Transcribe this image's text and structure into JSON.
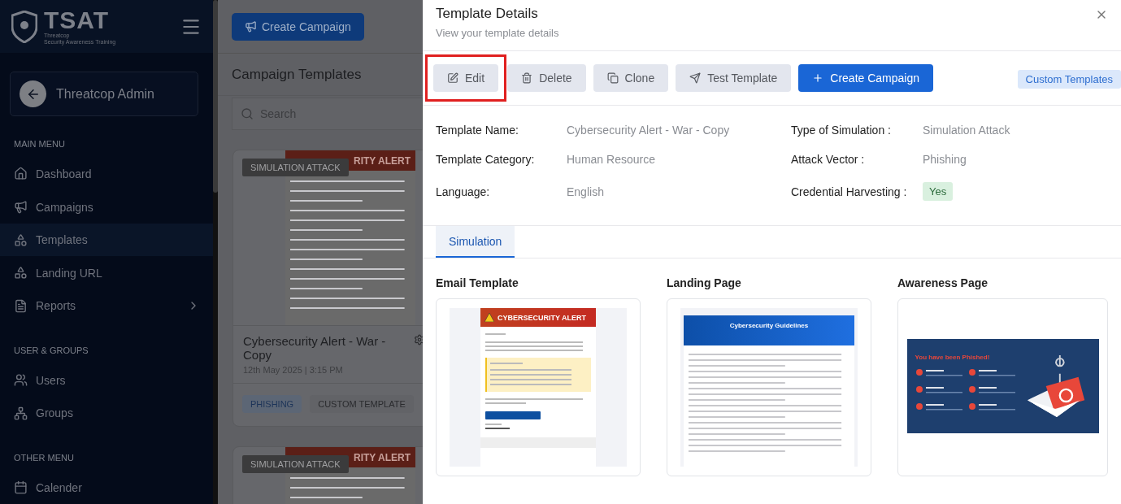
{
  "sidebar": {
    "logo": {
      "name": "TSAT",
      "line1": "Threatcop",
      "line2": "Security Awareness Training"
    },
    "account": "Threatcop Admin",
    "sections": [
      {
        "title": "MAIN MENU",
        "items": [
          {
            "label": "Dashboard",
            "selected": false
          },
          {
            "label": "Campaigns",
            "selected": false
          },
          {
            "label": "Templates",
            "selected": true
          },
          {
            "label": "Landing URL",
            "selected": false
          },
          {
            "label": "Reports",
            "selected": false,
            "expanded": false
          }
        ]
      },
      {
        "title": "USER & GROUPS",
        "items": [
          {
            "label": "Users",
            "selected": false
          },
          {
            "label": "Groups",
            "selected": false
          }
        ]
      },
      {
        "title": "OTHER MENU",
        "items": [
          {
            "label": "Calender",
            "selected": false
          }
        ]
      }
    ]
  },
  "page": {
    "create_button": "Create Campaign",
    "title": "Campaign Templates",
    "search": {
      "placeholder": "Search"
    },
    "cards": [
      {
        "banner": "RITY ALERT",
        "badge": "SIMULATION ATTACK",
        "title": "Cybersecurity Alert - War - Copy",
        "date": "12th May 2025 | 3:15 PM",
        "tags": [
          {
            "label": "PHISHING",
            "kind": "vector"
          },
          {
            "label": "CUSTOM TEMPLATE",
            "kind": "source"
          }
        ]
      },
      {
        "banner": "RITY ALERT",
        "badge": "SIMULATION ATTACK"
      }
    ]
  },
  "drawer": {
    "title": "Template Details",
    "subtitle": "View your template details",
    "actions": [
      {
        "label": "Edit",
        "kind": "secondary",
        "highlighted": true
      },
      {
        "label": "Delete",
        "kind": "secondary",
        "highlighted": false
      },
      {
        "label": "Clone",
        "kind": "secondary",
        "highlighted": false
      },
      {
        "label": "Test Template",
        "kind": "secondary",
        "highlighted": false
      },
      {
        "label": "Create Campaign",
        "kind": "primary",
        "highlighted": false
      }
    ],
    "tag": "Custom Templates",
    "details": [
      {
        "label": "Template Name:",
        "value": "Cybersecurity Alert - War - Copy",
        "kind": "text"
      },
      {
        "label": "Type of Simulation :",
        "value": "Simulation Attack",
        "kind": "text"
      },
      {
        "label": "Template Category:",
        "value": "Human Resource",
        "kind": "text"
      },
      {
        "label": "Attack Vector :",
        "value": "Phishing",
        "kind": "text"
      },
      {
        "label": "Language:",
        "value": "English",
        "kind": "text"
      },
      {
        "label": "Credential Harvesting :",
        "value": "Yes",
        "kind": "badge"
      }
    ],
    "tabs": [
      {
        "label": "Simulation",
        "selected": true
      }
    ],
    "previews": [
      {
        "title": "Email Template",
        "kind": "email",
        "heading": "CYBERSECURITY ALERT"
      },
      {
        "title": "Landing Page",
        "kind": "landing",
        "heading": "Cybersecurity Guidelines"
      },
      {
        "title": "Awareness Page",
        "kind": "awareness",
        "heading": "You have been Phished!"
      }
    ]
  }
}
